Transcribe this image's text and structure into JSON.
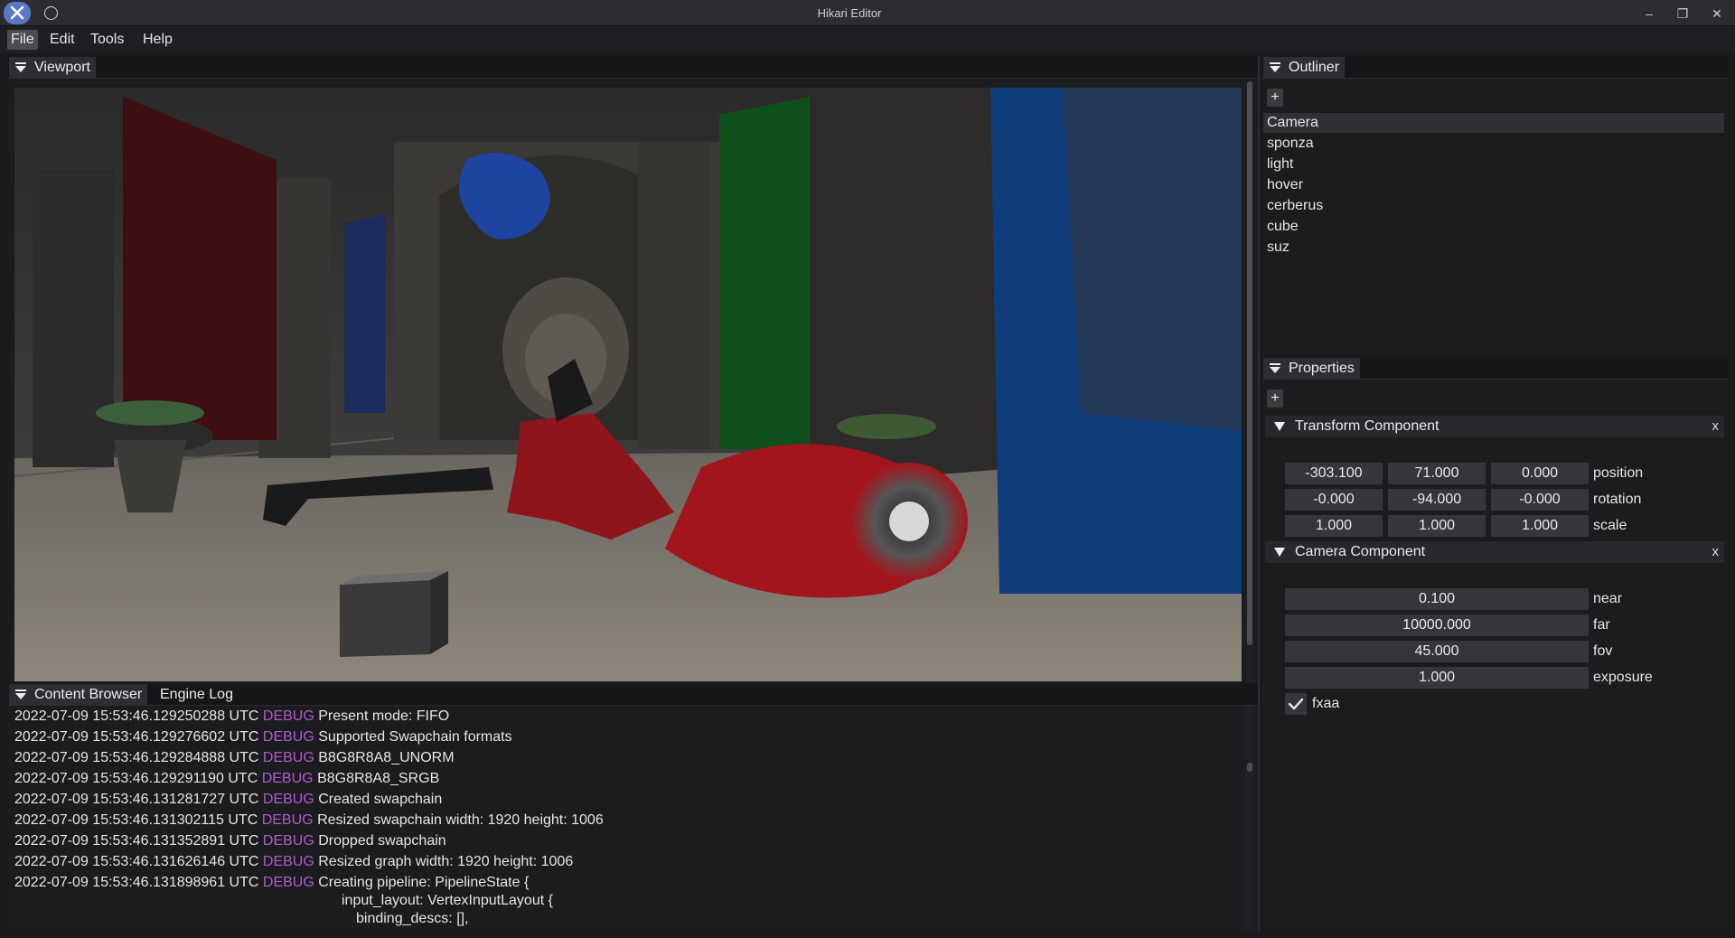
{
  "window": {
    "title": "Hikari Editor",
    "minimize": "–",
    "maximize": "❐",
    "close": "✕"
  },
  "menu": {
    "items": [
      "File",
      "Edit",
      "Tools",
      "Help"
    ]
  },
  "viewport": {
    "tab": "Viewport"
  },
  "bottom": {
    "tabs": [
      "Content Browser",
      "Engine Log"
    ],
    "log": [
      {
        "time": "2022-07-09 15:53:46.129250288 UTC",
        "level": "DEBUG",
        "msg": "Present mode: FIFO"
      },
      {
        "time": "2022-07-09 15:53:46.129276602 UTC",
        "level": "DEBUG",
        "msg": "Supported Swapchain formats"
      },
      {
        "time": "2022-07-09 15:53:46.129284888 UTC",
        "level": "DEBUG",
        "msg": "B8G8R8A8_UNORM"
      },
      {
        "time": "2022-07-09 15:53:46.129291190 UTC",
        "level": "DEBUG",
        "msg": "B8G8R8A8_SRGB"
      },
      {
        "time": "2022-07-09 15:53:46.131281727 UTC",
        "level": "DEBUG",
        "msg": "Created swapchain"
      },
      {
        "time": "2022-07-09 15:53:46.131302115 UTC",
        "level": "DEBUG",
        "msg": "Resized swapchain width: 1920 height: 1006"
      },
      {
        "time": "2022-07-09 15:53:46.131352891 UTC",
        "level": "DEBUG",
        "msg": "Dropped swapchain"
      },
      {
        "time": "2022-07-09 15:53:46.131626146 UTC",
        "level": "DEBUG",
        "msg": "Resized graph width: 1920 height: 1006"
      },
      {
        "time": "2022-07-09 15:53:46.131898961 UTC",
        "level": "DEBUG",
        "msg": "Creating pipeline: PipelineState {"
      }
    ],
    "log_continuation": [
      "input_layout: VertexInputLayout {",
      "binding_descs: [],"
    ]
  },
  "outliner": {
    "tab": "Outliner",
    "add": "+",
    "items": [
      "Camera",
      "sponza",
      "light",
      "hover",
      "cerberus",
      "cube",
      "suz"
    ],
    "selected": "Camera"
  },
  "properties": {
    "tab": "Properties",
    "add": "+",
    "transform": {
      "title": "Transform Component",
      "close": "x",
      "position": {
        "label": "position",
        "values": [
          "-303.100",
          "71.000",
          "0.000"
        ]
      },
      "rotation": {
        "label": "rotation",
        "values": [
          "-0.000",
          "-94.000",
          "-0.000"
        ]
      },
      "scale": {
        "label": "scale",
        "values": [
          "1.000",
          "1.000",
          "1.000"
        ]
      }
    },
    "camera": {
      "title": "Camera Component",
      "close": "x",
      "near": {
        "label": "near",
        "value": "0.100"
      },
      "far": {
        "label": "far",
        "value": "10000.000"
      },
      "fov": {
        "label": "fov",
        "value": "45.000"
      },
      "exposure": {
        "label": "exposure",
        "value": "1.000"
      },
      "fxaa": {
        "label": "fxaa",
        "checked": true
      }
    }
  },
  "colors": {
    "accent_debug": "#b15bd0",
    "background": "#1b1c1e",
    "tab_active": "#2c2e33"
  }
}
